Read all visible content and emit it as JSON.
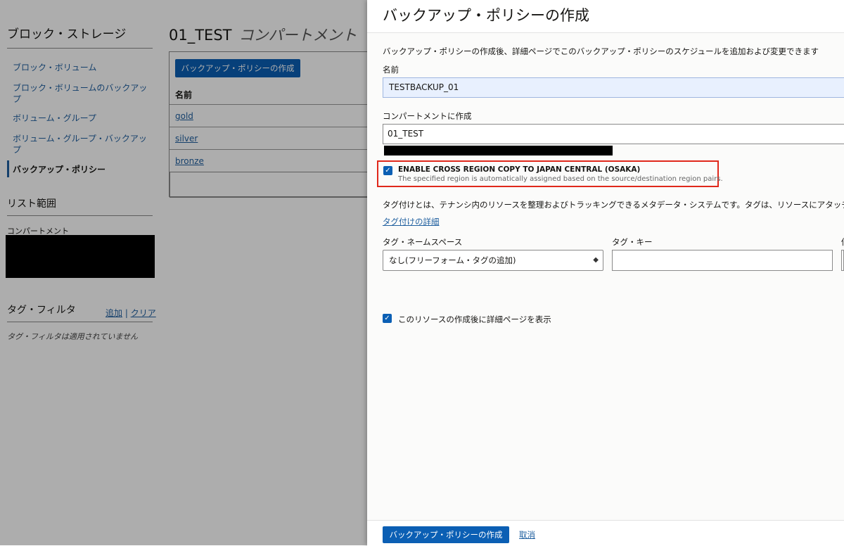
{
  "sidebar": {
    "title": "ブロック・ストレージ",
    "items": [
      {
        "label": "ブロック・ボリューム"
      },
      {
        "label": "ブロック・ボリュームのバックアップ"
      },
      {
        "label": "ボリューム・グループ"
      },
      {
        "label": "ボリューム・グループ・バックアップ"
      },
      {
        "label": "バックアップ・ポリシー"
      }
    ],
    "scope_title": "リスト範囲",
    "compartment_label": "コンパートメント",
    "tag_filter_title": "タグ・フィルタ",
    "tag_add": "追加",
    "tag_separator": "|",
    "tag_clear": "クリア",
    "tag_empty": "タグ・フィルタは適用されていません"
  },
  "main": {
    "title": "01_TEST",
    "subtitle": "コンパートメント",
    "create_button": "バックアップ・ポリシーの作成",
    "column_name": "名前",
    "rows": [
      "gold",
      "silver",
      "bronze"
    ]
  },
  "panel": {
    "title": "バックアップ・ポリシーの作成",
    "description": "バックアップ・ポリシーの作成後、詳細ページでこのバックアップ・ポリシーのスケジュールを追加および変更できます",
    "name_label": "名前",
    "name_value": "TESTBACKUP_01",
    "compartment_label": "コンパートメントに作成",
    "compartment_value": "01_TEST",
    "cross_region": {
      "title_prefix": "ENABLE CROSS REGION COPY TO ",
      "region": "JAPAN CENTRAL (OSAKA)",
      "subtitle": "The specified region is automatically assigned based on the source/destination region pairs.",
      "checked": true
    },
    "tag_description": "タグ付けとは、テナンシ内のリソースを整理およびトラッキングできるメタデータ・システムです。タグは、リソースにアタッチ",
    "tag_details_link": "タグ付けの詳細",
    "tag_namespace_label": "タグ・ネームスペース",
    "tag_namespace_value": "なし(フリーフォーム・タグの追加)",
    "tag_key_label": "タグ・キー",
    "tag_value_label": "値",
    "show_details_label": "このリソースの作成後に詳細ページを表示",
    "show_details_checked": true,
    "submit_button": "バックアップ・ポリシーの作成",
    "cancel_link": "取消"
  },
  "colors": {
    "primary": "#0b5fb4",
    "link": "#1f5f9f",
    "highlight_border": "#e0281b"
  }
}
